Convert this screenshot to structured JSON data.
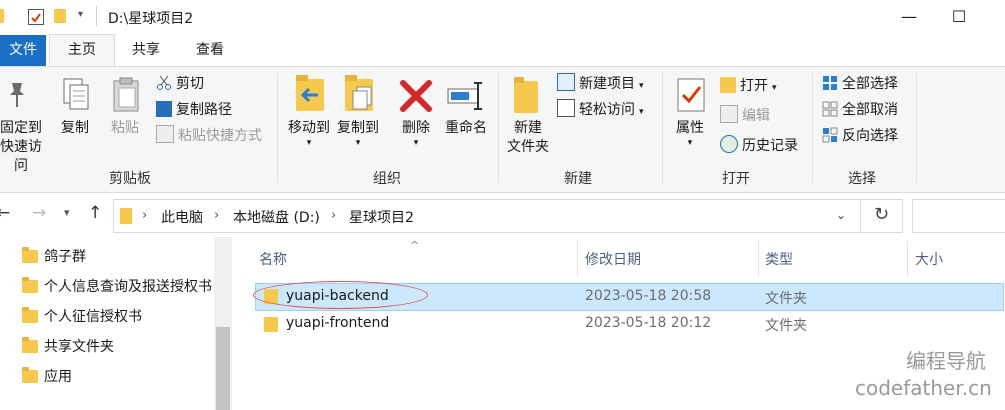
{
  "window": {
    "title": "D:\\星球项目2",
    "minimize": "—",
    "maximize": "☐"
  },
  "tabs": {
    "file": "文件",
    "home": "主页",
    "share": "共享",
    "view": "查看"
  },
  "ribbon": {
    "clipboard": {
      "pin": "固定到\n快速访问",
      "pin_l1": "固定到",
      "pin_l2": "快速访问",
      "copy": "复制",
      "paste": "粘贴",
      "cut": "剪切",
      "copy_path": "复制路径",
      "paste_shortcut": "粘贴快捷方式",
      "label": "剪贴板"
    },
    "organize": {
      "move_to": "移动到",
      "copy_to": "复制到",
      "delete": "删除",
      "rename": "重命名",
      "label": "组织"
    },
    "new": {
      "new_folder_l1": "新建",
      "new_folder_l2": "文件夹",
      "new_item": "新建项目",
      "easy_access": "轻松访问",
      "label": "新建"
    },
    "open": {
      "properties": "属性",
      "open": "打开",
      "edit": "编辑",
      "history": "历史记录",
      "label": "打开"
    },
    "select": {
      "select_all": "全部选择",
      "select_none": "全部取消",
      "invert": "反向选择",
      "label": "选择"
    }
  },
  "address": {
    "crumbs": [
      "此电脑",
      "本地磁盘 (D:)",
      "星球项目2"
    ],
    "refresh": "↻"
  },
  "nav_pane": {
    "items": [
      "鸽子群",
      "个人信息查询及报送授权书",
      "个人征信授权书",
      "共享文件夹",
      "应用"
    ]
  },
  "file_list": {
    "columns": {
      "name": "名称",
      "date": "修改日期",
      "type": "类型",
      "size": "大小"
    },
    "rows": [
      {
        "name": "yuapi-backend",
        "date": "2023-05-18 20:58",
        "type": "文件夹",
        "selected": true
      },
      {
        "name": "yuapi-frontend",
        "date": "2023-05-18 20:12",
        "type": "文件夹",
        "selected": false
      }
    ]
  },
  "watermark": {
    "line1": "编程导航",
    "line2": "codefather.cn"
  },
  "colors": {
    "accent": "#1a6fc4",
    "selection": "#cce8ff",
    "annotation": "#e05050"
  }
}
